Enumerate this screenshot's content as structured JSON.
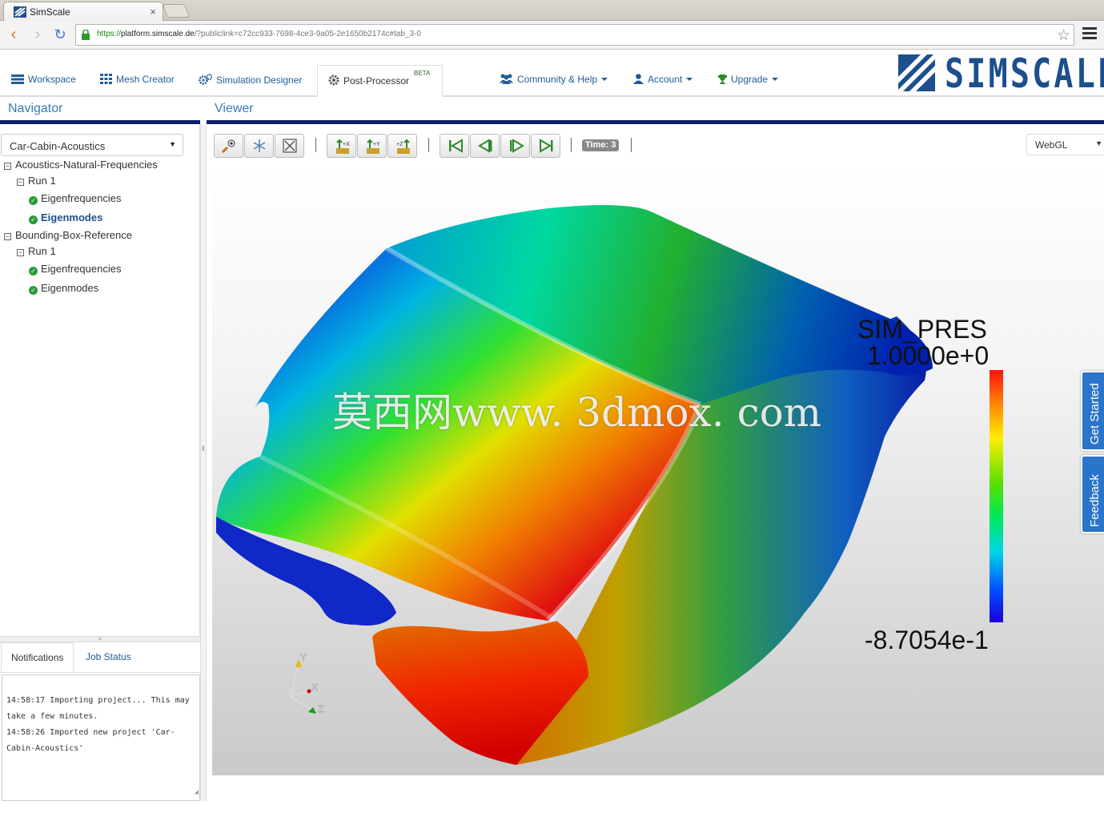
{
  "browser": {
    "tab_title": "SimScale",
    "tab_close": "×",
    "url_scheme": "https://",
    "url_host": "platform.simscale.de",
    "url_path": "/?publiclink=c72cc933-7698-4ce3-9a05-2e1650b2174c#tab_3-0"
  },
  "appnav": {
    "items": [
      {
        "label": "Workspace",
        "icon": "workspace-icon"
      },
      {
        "label": "Mesh Creator",
        "icon": "grid-icon"
      },
      {
        "label": "Simulation Designer",
        "icon": "gears-icon"
      },
      {
        "label": "Post-Processor",
        "icon": "gear-icon",
        "badge": "BETA"
      },
      {
        "label": "Community & Help",
        "icon": "users-icon"
      },
      {
        "label": "Account",
        "icon": "user-icon"
      },
      {
        "label": "Upgrade",
        "icon": "trophy-icon"
      }
    ],
    "logo_text": "SIMSCALE"
  },
  "navigator": {
    "title": "Navigator",
    "project_select": "Car-Cabin-Acoustics",
    "tree": [
      {
        "label": "Acoustics-Natural-Frequencies"
      },
      {
        "label": "Run 1"
      },
      {
        "label": "Eigenfrequencies"
      },
      {
        "label": "Eigenmodes"
      },
      {
        "label": "Bounding-Box-Reference"
      },
      {
        "label": "Run 1"
      },
      {
        "label": "Eigenfrequencies"
      },
      {
        "label": "Eigenmodes"
      }
    ]
  },
  "bottom_panel": {
    "tabs": [
      "Notifications",
      "Job Status"
    ],
    "log": [
      "14:58:17 Importing project... This may take a few minutes.",
      "14:58:26 Imported new project 'Car-Cabin-Acoustics'"
    ]
  },
  "viewer": {
    "title": "Viewer",
    "time_label": "Time: 3",
    "renderer": "WebGL",
    "legend": {
      "title": "SIM_PRES",
      "max": "1.0000e+0",
      "min": "-8.7054e-1"
    },
    "axes": {
      "x": "X",
      "y": "Y",
      "z": "Z"
    },
    "watermark": "莫西网www. 3dmox. com"
  },
  "side_tabs": [
    "Get Started",
    "Feedback"
  ],
  "colors": {
    "nav_link": "#1f5c97",
    "header_rule": "#0b1f6e",
    "side_tab": "#2a74c9"
  }
}
